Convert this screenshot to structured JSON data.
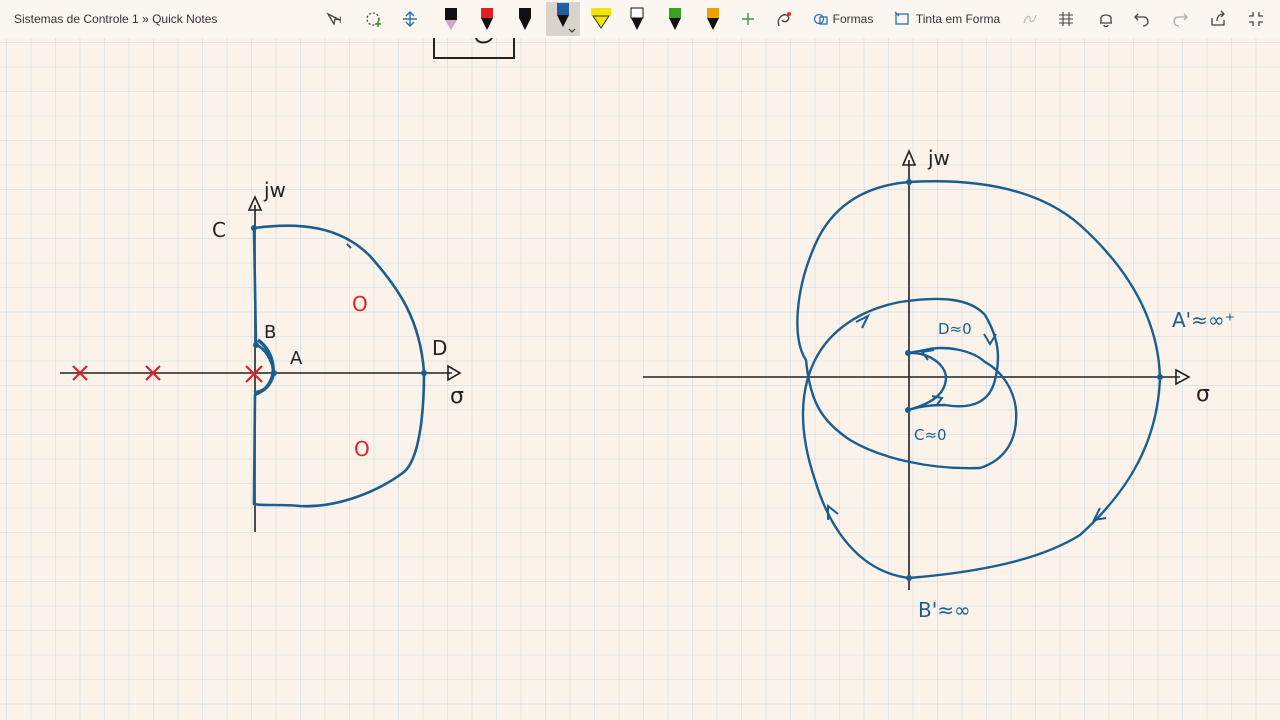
{
  "breadcrumb": "Sistemas de Controle 1 » Quick Notes",
  "toolbar": {
    "shapes_label": "Formas",
    "ink_to_shape_label": "Tinta em Forma",
    "pen_colors": [
      "#111111",
      "#e02020",
      "#111111",
      "#1f5f9e",
      "#f2e600",
      "#111111",
      "#3aa020",
      "#f0a000"
    ],
    "selected_pen_index": 3
  },
  "colors": {
    "ink_blue": "#1a5e8f",
    "ink_red": "#e0202a",
    "axis": "#222222",
    "paper": "#fbf3ea"
  },
  "left_sketch": {
    "axis_jw": "jw",
    "axis_sigma": "σ",
    "label_c": "C",
    "label_b": "B",
    "label_a": "A",
    "label_d": "D",
    "zero_symbol": "O",
    "pole_symbol": "×"
  },
  "right_sketch": {
    "axis_jw": "jw",
    "axis_sigma": "σ",
    "label_a_prime": "A'≈∞⁺",
    "label_b_prime": "B'≈∞",
    "label_c_zero": "C≈0",
    "label_d_zero": "D≈0"
  }
}
